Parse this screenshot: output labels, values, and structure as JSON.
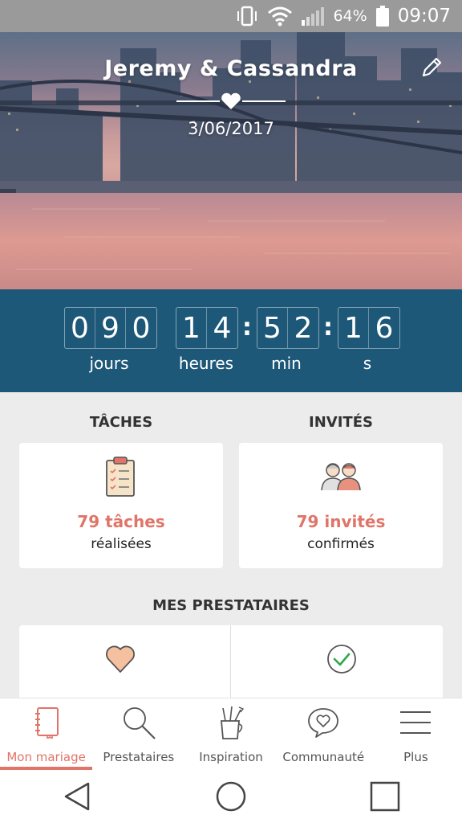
{
  "status_bar": {
    "battery": "64%",
    "time": "09:07"
  },
  "hero": {
    "couple": "Jeremy & Cassandra",
    "date": "3/06/2017"
  },
  "countdown": {
    "days": [
      "0",
      "9",
      "0"
    ],
    "hours": [
      "1",
      "4"
    ],
    "minutes": [
      "5",
      "2"
    ],
    "seconds": [
      "1",
      "6"
    ],
    "labels": {
      "days": "jours",
      "hours": "heures",
      "minutes": "min",
      "seconds": "s"
    }
  },
  "tasks": {
    "title": "TÂCHES",
    "count": "79 tâches",
    "label": "réalisées"
  },
  "guests": {
    "title": "INVITÉS",
    "count": "79 invités",
    "label": "confirmés"
  },
  "vendors": {
    "title": "MES PRESTATAIRES"
  },
  "nav": {
    "items": [
      {
        "label": "Mon mariage",
        "icon": "notebook-icon",
        "active": true
      },
      {
        "label": "Prestataires",
        "icon": "search-icon",
        "active": false
      },
      {
        "label": "Inspiration",
        "icon": "pencil-cup-icon",
        "active": false
      },
      {
        "label": "Communauté",
        "icon": "heart-chat-icon",
        "active": false
      },
      {
        "label": "Plus",
        "icon": "menu-icon",
        "active": false
      }
    ]
  },
  "colors": {
    "accent": "#e07469",
    "countdown_bg": "#1d5879",
    "page_bg": "#ececec"
  }
}
